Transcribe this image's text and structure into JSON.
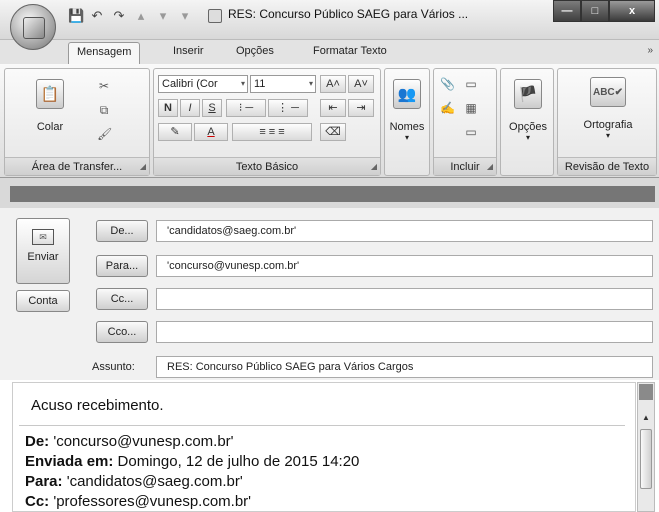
{
  "window": {
    "title": "RES: Concurso Público SAEG para Vários ...",
    "controls": {
      "minimize": "—",
      "maximize": "□",
      "close": "x"
    }
  },
  "quick_access": {
    "save": "💾",
    "undo": "↶",
    "redo": "↷",
    "more": "▾"
  },
  "tabs": {
    "mensagem": "Mensagem",
    "inserir": "Inserir",
    "opcoes": "Opções",
    "formatar": "Formatar Texto",
    "chevron": "»"
  },
  "ribbon": {
    "clipboard": {
      "paste": "Colar",
      "label": "Área de Transfer...",
      "cut_icon": "✂",
      "copy_icon": "⧉",
      "painter_icon": "🖌"
    },
    "basic_text": {
      "font": "Calibri (Cor",
      "size": "11",
      "grow": "A˄",
      "shrink": "A˅",
      "bold": "N",
      "italic": "I",
      "underline": "S",
      "bullets": "⁝ ─",
      "numbering": "⋮ ─",
      "outdent": "⇤",
      "indent": "⇥",
      "highlight": "✎",
      "fontcolor": "A",
      "clear": "⌫",
      "label": "Texto Básico"
    },
    "names": {
      "label": "Nomes",
      "icon": "👥",
      "dropdown": "▾"
    },
    "include": {
      "label": "Incluir",
      "attach": "📎",
      "card": "▭",
      "calendar": "▦",
      "signature": "✍"
    },
    "options": {
      "label": "Opções",
      "icon": "🏴"
    },
    "proofing": {
      "spelling": "Ortografia",
      "label": "Revisão de Texto",
      "icon": "ABC✔"
    }
  },
  "compose": {
    "send": "Enviar",
    "account": "Conta",
    "from_button": "De...",
    "to_button": "Para...",
    "cc_button": "Cc...",
    "bcc_button": "Cco...",
    "subject_label": "Assunto:",
    "from_value": "'candidatos@saeg.com.br'",
    "to_value": "'concurso@vunesp.com.br'",
    "cc_value": "",
    "bcc_value": "",
    "subject_value": "RES: Concurso Público SAEG para Vários Cargos"
  },
  "body": {
    "greeting": "Acuso recebimento.",
    "de_label": "De:",
    "de_value": " 'concurso@vunesp.com.br'",
    "sent_label": "Enviada em:",
    "sent_value": " Domingo, 12 de julho de 2015  14:20",
    "para_label": "Para:",
    "para_value": " 'candidatos@saeg.com.br'",
    "cc_label": "Cc:",
    "cc_value": " 'professores@vunesp.com.br'"
  }
}
